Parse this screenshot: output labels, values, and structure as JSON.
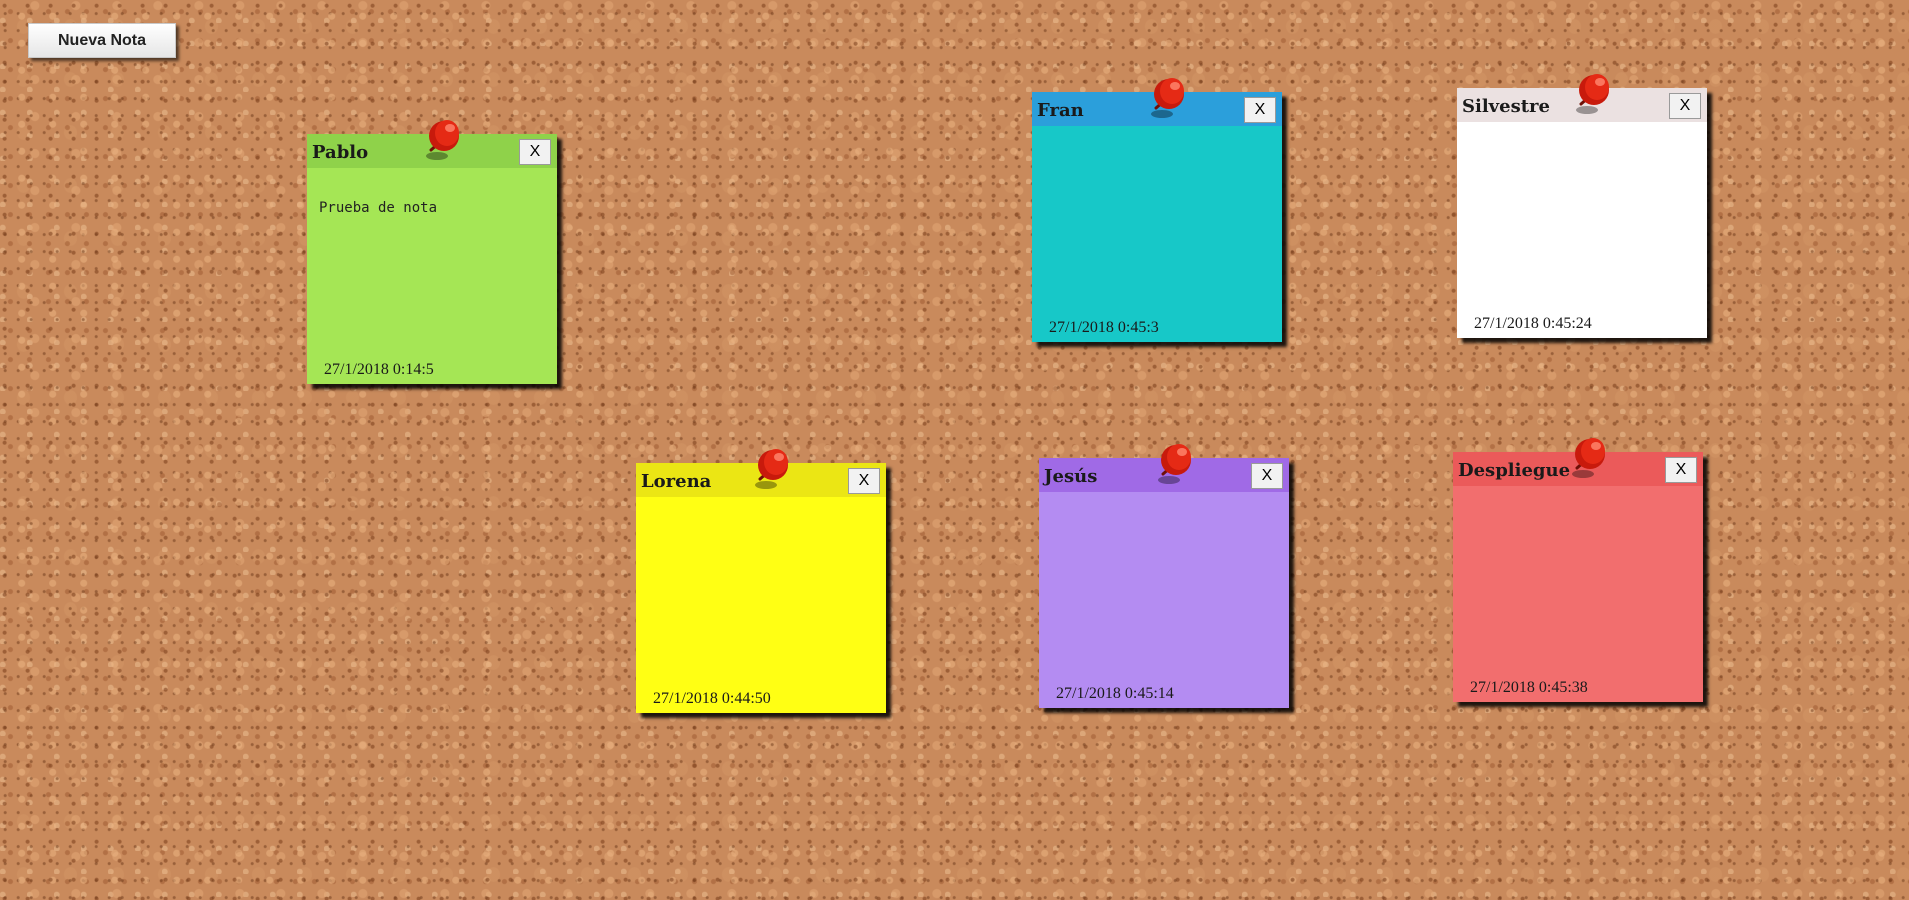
{
  "toolbar": {
    "new_note_label": "Nueva Nota"
  },
  "notes": [
    {
      "title": "Pablo",
      "content": "Prueba de nota",
      "date": "27/1/2018 0:14:5",
      "close_label": "X",
      "body_color": "#a5e655",
      "header_color": "#8fd24a"
    },
    {
      "title": "Fran",
      "content": "",
      "date": "27/1/2018 0:45:3",
      "close_label": "X",
      "body_color": "#17c8c8",
      "header_color": "#2b9fdb"
    },
    {
      "title": "Silvestre",
      "content": "",
      "date": "27/1/2018 0:45:24",
      "close_label": "X",
      "body_color": "#ffffff",
      "header_color": "#ebe1e1"
    },
    {
      "title": "Lorena",
      "content": "",
      "date": "27/1/2018 0:44:50",
      "close_label": "X",
      "body_color": "#ffff14",
      "header_color": "#ebe614"
    },
    {
      "title": "Jesús",
      "content": "",
      "date": "27/1/2018 0:45:14",
      "close_label": "X",
      "body_color": "#b48cf2",
      "header_color": "#a06ae6"
    },
    {
      "title": "Despliegue",
      "content": "",
      "date": "27/1/2018 0:45:38",
      "close_label": "X",
      "body_color": "#f26e6e",
      "header_color": "#eb5a5a"
    }
  ],
  "icons": {
    "pin": "pushpin-icon",
    "close": "close-icon"
  },
  "colors": {
    "pin_red": "#d41f0f",
    "board": "#c98a5c"
  }
}
